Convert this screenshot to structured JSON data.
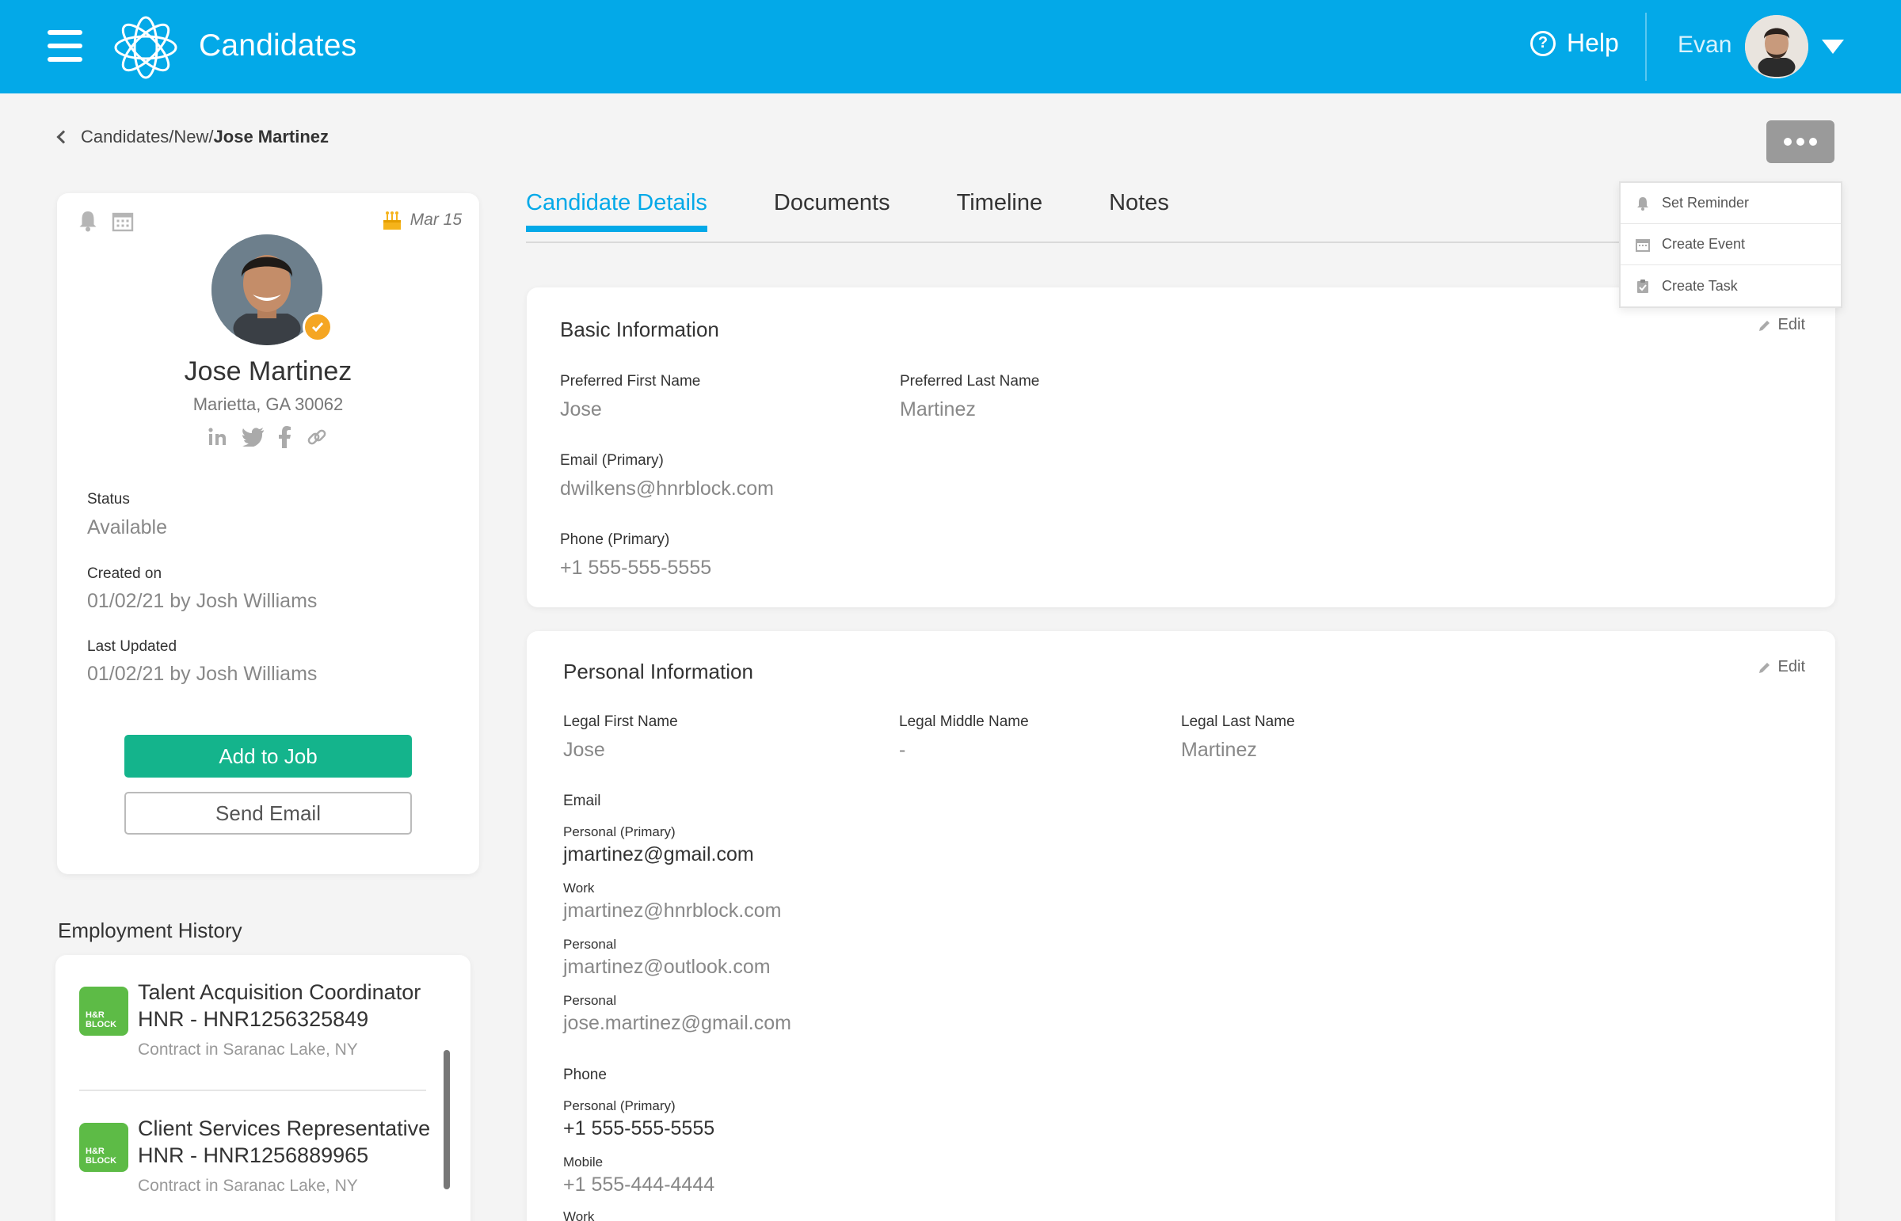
{
  "header": {
    "app_title": "Candidates",
    "help_label": "Help",
    "user_name": "Evan",
    "brand_color": "#03a9e8"
  },
  "breadcrumb": {
    "path": "Candidates/New/",
    "current": "Jose Martinez"
  },
  "more_menu": {
    "items": [
      {
        "label": "Set Reminder",
        "icon": "bell-icon"
      },
      {
        "label": "Create Event",
        "icon": "calendar-icon"
      },
      {
        "label": "Create Task",
        "icon": "clipboard-icon"
      }
    ]
  },
  "profile": {
    "date": "Mar 15",
    "name": "Jose Martinez",
    "location": "Marietta, GA 30062",
    "status_label": "Status",
    "status_value": "Available",
    "created_label": "Created on",
    "created_value": "01/02/21 by Josh Williams",
    "updated_label": "Last Updated",
    "updated_value": "01/02/21 by Josh Williams",
    "add_to_job": "Add to Job",
    "send_email": "Send Email",
    "social_icons": [
      "linkedin-icon",
      "twitter-icon",
      "facebook-icon",
      "link-icon"
    ],
    "accent_green": "#14b48c"
  },
  "employment": {
    "title": "Employment History",
    "items": [
      {
        "logo_text": "H&R BLOCK",
        "role": "Talent Acquisition Coordinator",
        "id": "HNR - HNR1256325849",
        "meta": "Contract in Saranac Lake, NY"
      },
      {
        "logo_text": "H&R BLOCK",
        "role": "Client Services Representative",
        "id": "HNR - HNR1256889965",
        "meta": "Contract in Saranac Lake, NY"
      }
    ]
  },
  "tabs": [
    {
      "label": "Candidate Details",
      "active": true
    },
    {
      "label": "Documents",
      "active": false
    },
    {
      "label": "Timeline",
      "active": false
    },
    {
      "label": "Notes",
      "active": false
    }
  ],
  "basic_info": {
    "title": "Basic Information",
    "edit_label": "Edit",
    "first_name_label": "Preferred First Name",
    "first_name": "Jose",
    "last_name_label": "Preferred Last Name",
    "last_name": "Martinez",
    "email_label": "Email (Primary)",
    "email": "dwilkens@hnrblock.com",
    "phone_label": "Phone (Primary)",
    "phone": "+1 555-555-5555"
  },
  "personal_info": {
    "title": "Personal Information",
    "edit_label": "Edit",
    "legal_first_label": "Legal First Name",
    "legal_first": "Jose",
    "legal_middle_label": "Legal Middle Name",
    "legal_middle": "-",
    "legal_last_label": "Legal Last Name",
    "legal_last": "Martinez",
    "email_label": "Email",
    "emails": [
      {
        "type": "Personal (Primary)",
        "value": "jmartinez@gmail.com"
      },
      {
        "type": "Work",
        "value": "jmartinez@hnrblock.com"
      },
      {
        "type": "Personal",
        "value": "jmartinez@outlook.com"
      },
      {
        "type": "Personal",
        "value": "jose.martinez@gmail.com"
      }
    ],
    "phone_label": "Phone",
    "phones": [
      {
        "type": "Personal (Primary)",
        "value": "+1 555-555-5555"
      },
      {
        "type": "Mobile",
        "value": "+1 555-444-4444"
      },
      {
        "type": "Work",
        "value": ""
      }
    ]
  }
}
